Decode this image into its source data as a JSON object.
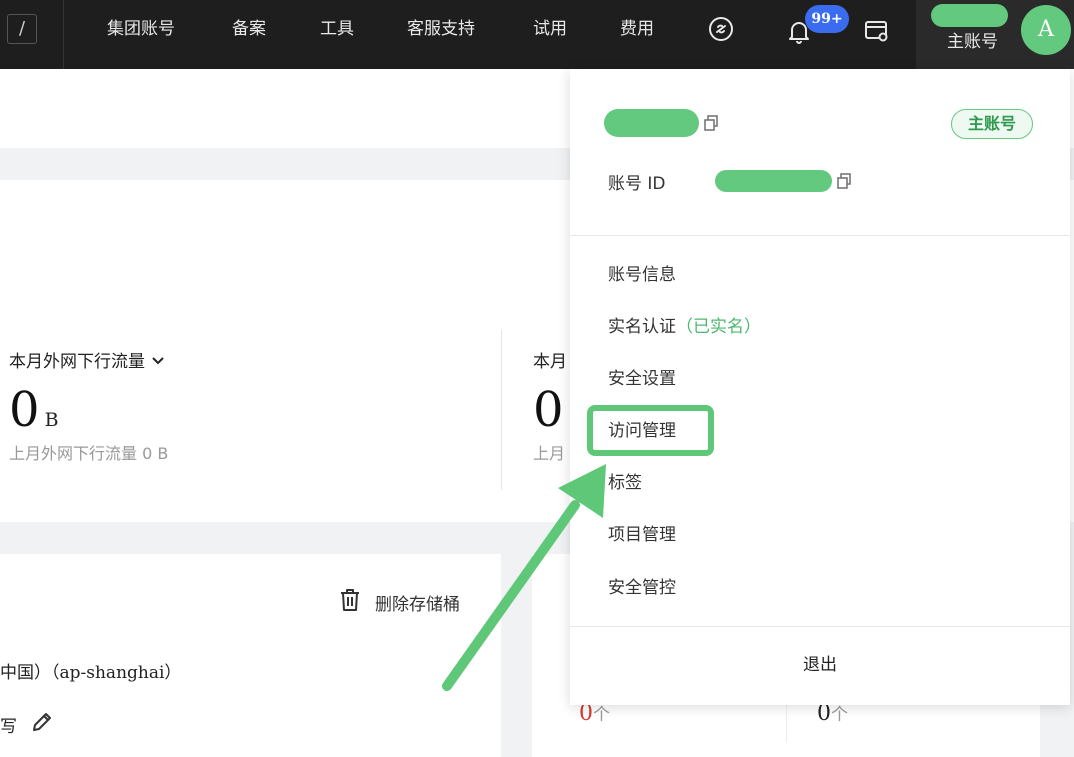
{
  "topbar": {
    "slash": "/",
    "nav": [
      "集团账号",
      "备案",
      "工具",
      "客服支持",
      "试用",
      "费用"
    ],
    "notification_count": "99+",
    "account_label": "主账号",
    "avatar_letter": "A"
  },
  "stats": [
    {
      "title": "本月外网下行流量",
      "value": "0",
      "unit": "B",
      "sub": "上月外网下行流量 0 B"
    },
    {
      "title": "本月",
      "value": "0",
      "unit": "",
      "sub": "上月"
    }
  ],
  "bucket": {
    "delete_label": "删除存储桶",
    "region": "中国）（ap-shanghai）",
    "write_label": "写"
  },
  "counts": [
    {
      "value": "0",
      "unit": "个",
      "color": "#d9362b"
    },
    {
      "value": "0",
      "unit": "个",
      "color": "#222222"
    }
  ],
  "dropdown": {
    "main_badge": "主账号",
    "account_id_label": "账号 ID",
    "menu": [
      {
        "label": "账号信息",
        "suffix": ""
      },
      {
        "label": "实名认证",
        "suffix": "（已实名）"
      },
      {
        "label": "安全设置",
        "suffix": ""
      },
      {
        "label": "访问管理",
        "suffix": ""
      },
      {
        "label": "标签",
        "suffix": ""
      },
      {
        "label": "项目管理",
        "suffix": ""
      },
      {
        "label": "安全管控",
        "suffix": ""
      }
    ],
    "logout": "退出"
  },
  "colors": {
    "accent_green": "#62c97f",
    "badge_blue": "#3b6cf0",
    "topbar": "#1e1e1e"
  }
}
